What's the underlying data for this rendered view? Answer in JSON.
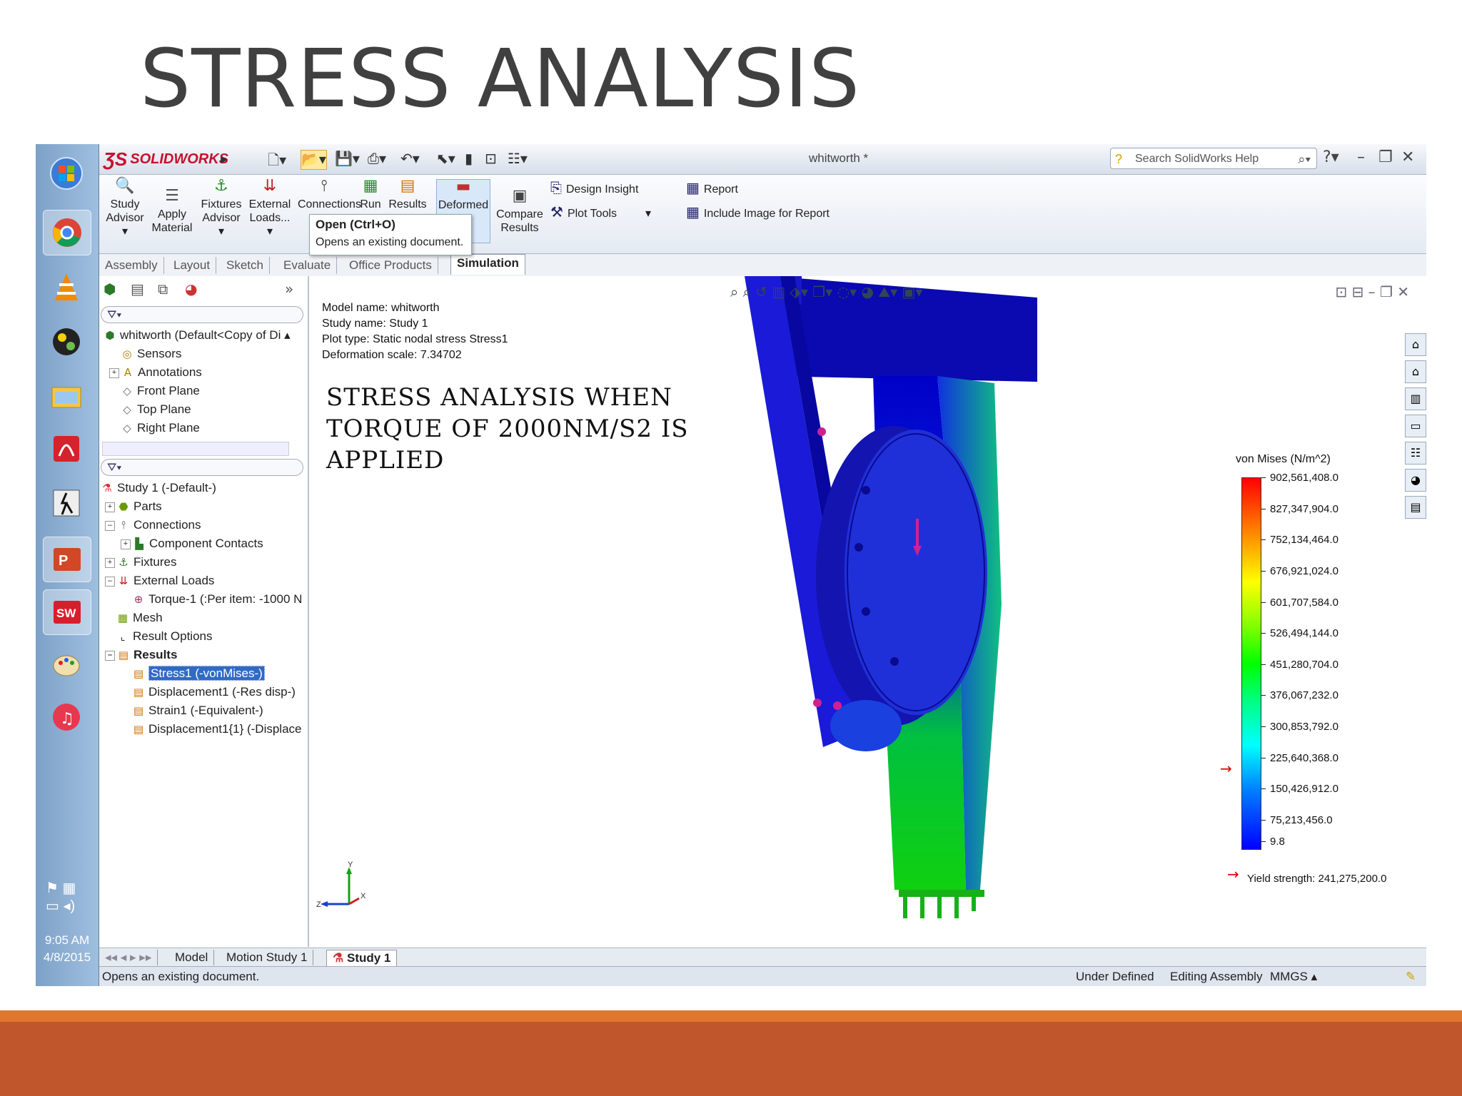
{
  "slide": {
    "title": "STRESS ANALYSIS",
    "accent_color": "#c0562b",
    "stripe_color": "#e0772e"
  },
  "taskbar": {
    "clock_time": "9:05 AM",
    "clock_date": "4/8/2015",
    "apps": [
      "start-orb-icon",
      "chrome-icon",
      "vlc-icon",
      "media-icon",
      "explorer-icon",
      "acrobat-icon",
      "game-icon",
      "powerpoint-icon",
      "solidworks-icon",
      "paint-icon",
      "itunes-icon"
    ]
  },
  "window": {
    "brand": "SOLIDWORKS",
    "title": "whitworth *",
    "search_placeholder": "Search SolidWorks Help"
  },
  "commands": {
    "study_advisor": "Study Advisor",
    "apply_material": "Apply Material",
    "fixtures_advisor": "Fixtures Advisor",
    "external_loads": "External Loads...",
    "connections": "Connections",
    "run": "Run",
    "results": "Results",
    "deformed": "Deformed",
    "compare_results": "Compare Results",
    "design_insight": "Design Insight",
    "plot_tools": "Plot Tools",
    "report": "Report",
    "include_image": "Include Image for Report"
  },
  "tooltip": {
    "title": "Open  (Ctrl+O)",
    "text": "Opens an existing document."
  },
  "cmd_tabs": [
    "Assembly",
    "Layout",
    "Sketch",
    "Evaluate",
    "Office Products",
    "Simulation"
  ],
  "feature_tree": {
    "root": "whitworth  (Default<Copy of Di",
    "items": [
      "Sensors",
      "Annotations",
      "Front Plane",
      "Top Plane",
      "Right Plane"
    ]
  },
  "study_tree": {
    "root": "Study 1 (-Default-)",
    "parts": "Parts",
    "connections": "Connections",
    "component_contacts": "Component Contacts",
    "fixtures": "Fixtures",
    "external_loads": "External Loads",
    "torque": "Torque-1 (:Per item: -1000 N",
    "mesh": "Mesh",
    "result_options": "Result Options",
    "results": "Results",
    "stress": "Stress1 (-vonMises-)",
    "displacement": "Displacement1 (-Res disp-)",
    "strain": "Strain1 (-Equivalent-)",
    "displacement2": "Displacement1{1} (-Displace"
  },
  "plot_info": {
    "model": "Model name: whitworth",
    "study": "Study name: Study 1",
    "plot_type": "Plot type: Static nodal stress Stress1",
    "deformation": "Deformation scale: 7.34702"
  },
  "annotation": {
    "line1": "STRESS ANALYSIS WHEN",
    "line2": "TORQUE OF 2000NM/S2 IS",
    "line3": "APPLIED"
  },
  "legend": {
    "title": "von Mises (N/m^2)",
    "values": [
      "902,561,408.0",
      "827,347,904.0",
      "752,134,464.0",
      "676,921,024.0",
      "601,707,584.0",
      "526,494,144.0",
      "451,280,704.0",
      "376,067,232.0",
      "300,853,792.0",
      "225,640,368.0",
      "150,426,912.0",
      "75,213,456.0",
      "9.8"
    ],
    "yield": "Yield strength: 241,275,200.0"
  },
  "bottom_tabs": [
    "Model",
    "Motion Study 1",
    "Study 1"
  ],
  "status": {
    "message": "Opens an existing document.",
    "state": "Under Defined",
    "mode": "Editing Assembly",
    "units": "MMGS"
  }
}
